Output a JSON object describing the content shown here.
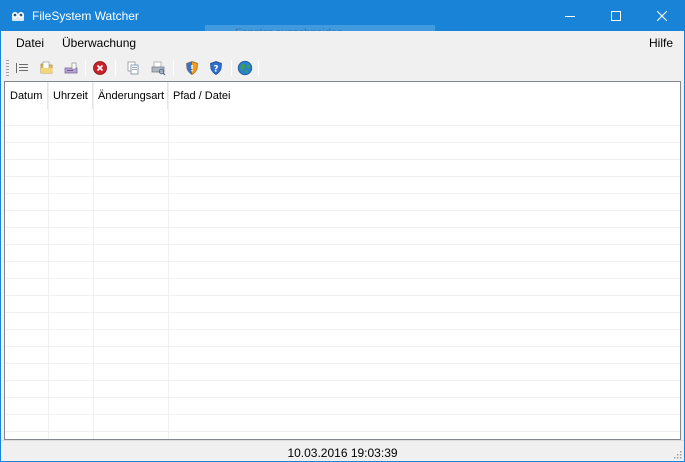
{
  "window": {
    "title": "FileSystem Watcher",
    "ghost_tooltip": "Fenster ausschneiden"
  },
  "menu": {
    "datei": "Datei",
    "ueberwachung": "Überwachung",
    "hilfe": "Hilfe"
  },
  "toolbar": {
    "icons": [
      "list-icon",
      "open-folder-icon",
      "save-icon",
      "stop-icon",
      "copy-icon",
      "print-icon",
      "shield-icon",
      "help-icon",
      "globe-icon"
    ]
  },
  "table": {
    "columns": [
      "Datum",
      "Uhrzeit",
      "Änderungsart",
      "Pfad / Datei"
    ],
    "rows": []
  },
  "status": {
    "datetime": "10.03.2016 19:03:39"
  },
  "colors": {
    "titlebar": "#1883d7",
    "chrome": "#f0f0f0"
  }
}
